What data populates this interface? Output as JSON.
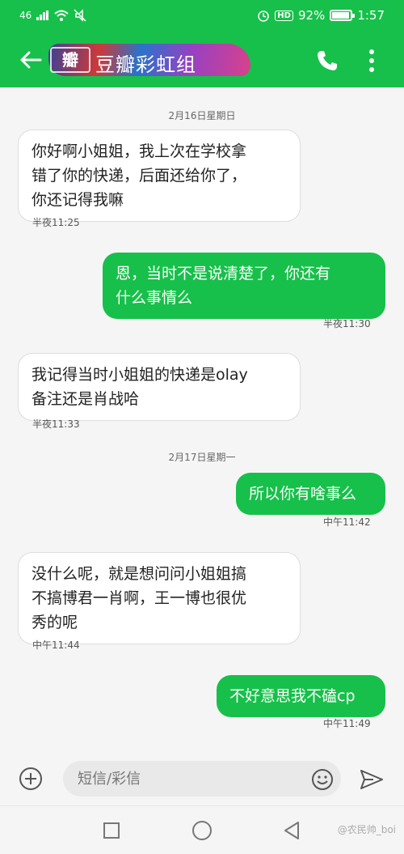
{
  "status_bar": {
    "signal": "46",
    "battery": "92%",
    "battery_fill_fraction": 0.92,
    "time": "1:57",
    "hd": "HD"
  },
  "header": {
    "title": "豆瓣彩虹组",
    "logo_text": "瓣",
    "back_icon": "back-arrow-icon",
    "call_icon": "phone-icon",
    "menu_icon": "more-icon"
  },
  "messages": {
    "date1": "2月16日星期日",
    "date2": "2月17日星期一",
    "items": [
      {
        "direction": "in",
        "text_lines": [
          "你好啊小姐姐，我上次在学校拿",
          "错了你的快递，后面还给你了，",
          "你还记得我嘛"
        ],
        "time": "半夜11:25"
      },
      {
        "direction": "out",
        "text_lines": [
          "恩，当时不是说清楚了，你还有",
          "什么事情么"
        ],
        "time": "半夜11:30"
      },
      {
        "direction": "in",
        "text_lines": [
          "我记得当时小姐姐的快递是olay",
          "备注还是肖战哈"
        ],
        "time": "半夜11:33"
      },
      {
        "direction": "out",
        "text_lines": [
          "所以你有啥事么"
        ],
        "time": "中午11:42"
      },
      {
        "direction": "in",
        "text_lines": [
          "没什么呢，就是想问问小姐姐搞",
          "不搞博君一肖啊，王一博也很优",
          "秀的呢"
        ],
        "time": "中午11:44"
      },
      {
        "direction": "out",
        "text_lines": [
          "不好意思我不磕cp"
        ],
        "time": "中午11:49"
      }
    ]
  },
  "input_bar": {
    "placeholder": "短信/彩信",
    "add_icon": "add-icon",
    "emoji_icon": "emoji-icon",
    "send_icon": "send-icon"
  },
  "nav_bar": {
    "watermark": "@农民帅_boi"
  },
  "colors": {
    "brand_green": "#17c04a",
    "background": "#f5f5f5"
  }
}
